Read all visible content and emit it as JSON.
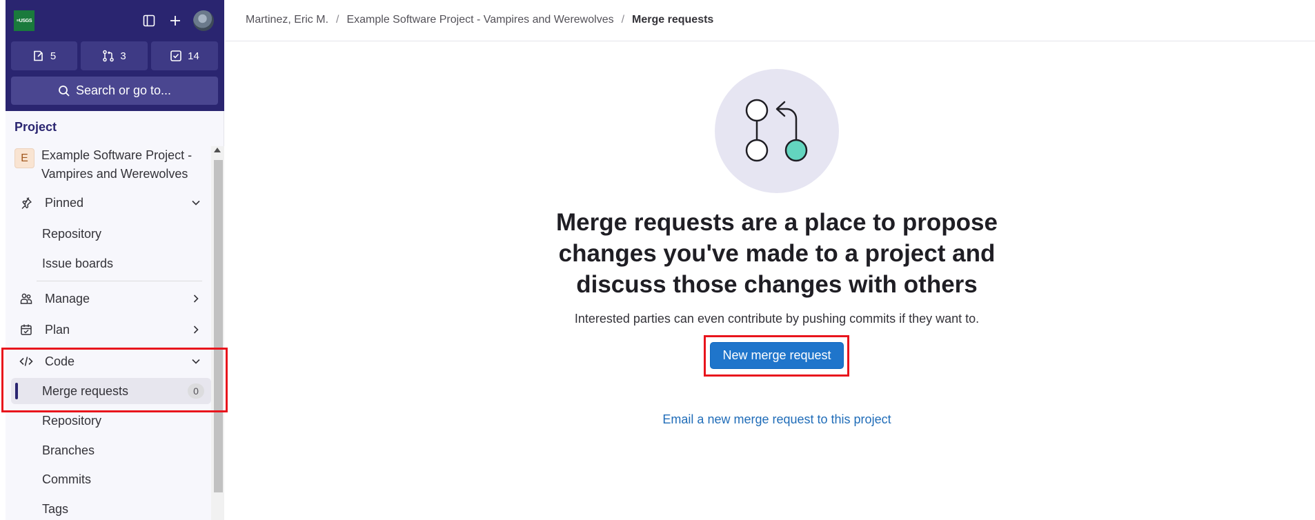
{
  "sidebar": {
    "logo_text": "≡USGS",
    "counters": [
      {
        "icon": "issues-icon",
        "count": "5"
      },
      {
        "icon": "merge-request-icon",
        "count": "3"
      },
      {
        "icon": "todo-icon",
        "count": "14"
      }
    ],
    "search_label": "Search or go to...",
    "section_label": "Project",
    "project": {
      "avatar_letter": "E",
      "name": "Example Software Project - Vampires and Werewolves"
    },
    "pinned_label": "Pinned",
    "pinned_items": [
      "Repository",
      "Issue boards"
    ],
    "manage_label": "Manage",
    "plan_label": "Plan",
    "code_label": "Code",
    "code_items": [
      {
        "label": "Merge requests",
        "badge": "0",
        "active": true
      },
      {
        "label": "Repository"
      },
      {
        "label": "Branches"
      },
      {
        "label": "Commits"
      },
      {
        "label": "Tags"
      }
    ]
  },
  "breadcrumb": [
    "Martinez, Eric M.",
    "Example Software Project - Vampires and Werewolves",
    "Merge requests"
  ],
  "empty_state": {
    "title": "Merge requests are a place to propose changes you've made to a project and discuss those changes with others",
    "description": "Interested parties can even contribute by pushing commits if they want to.",
    "button_label": "New merge request",
    "email_link": "Email a new merge request to this project"
  },
  "colors": {
    "sidebar_top": "#2a2570",
    "primary_button": "#1f75cb",
    "highlight": "#e8141c",
    "accent_teal": "#63d5bf"
  }
}
